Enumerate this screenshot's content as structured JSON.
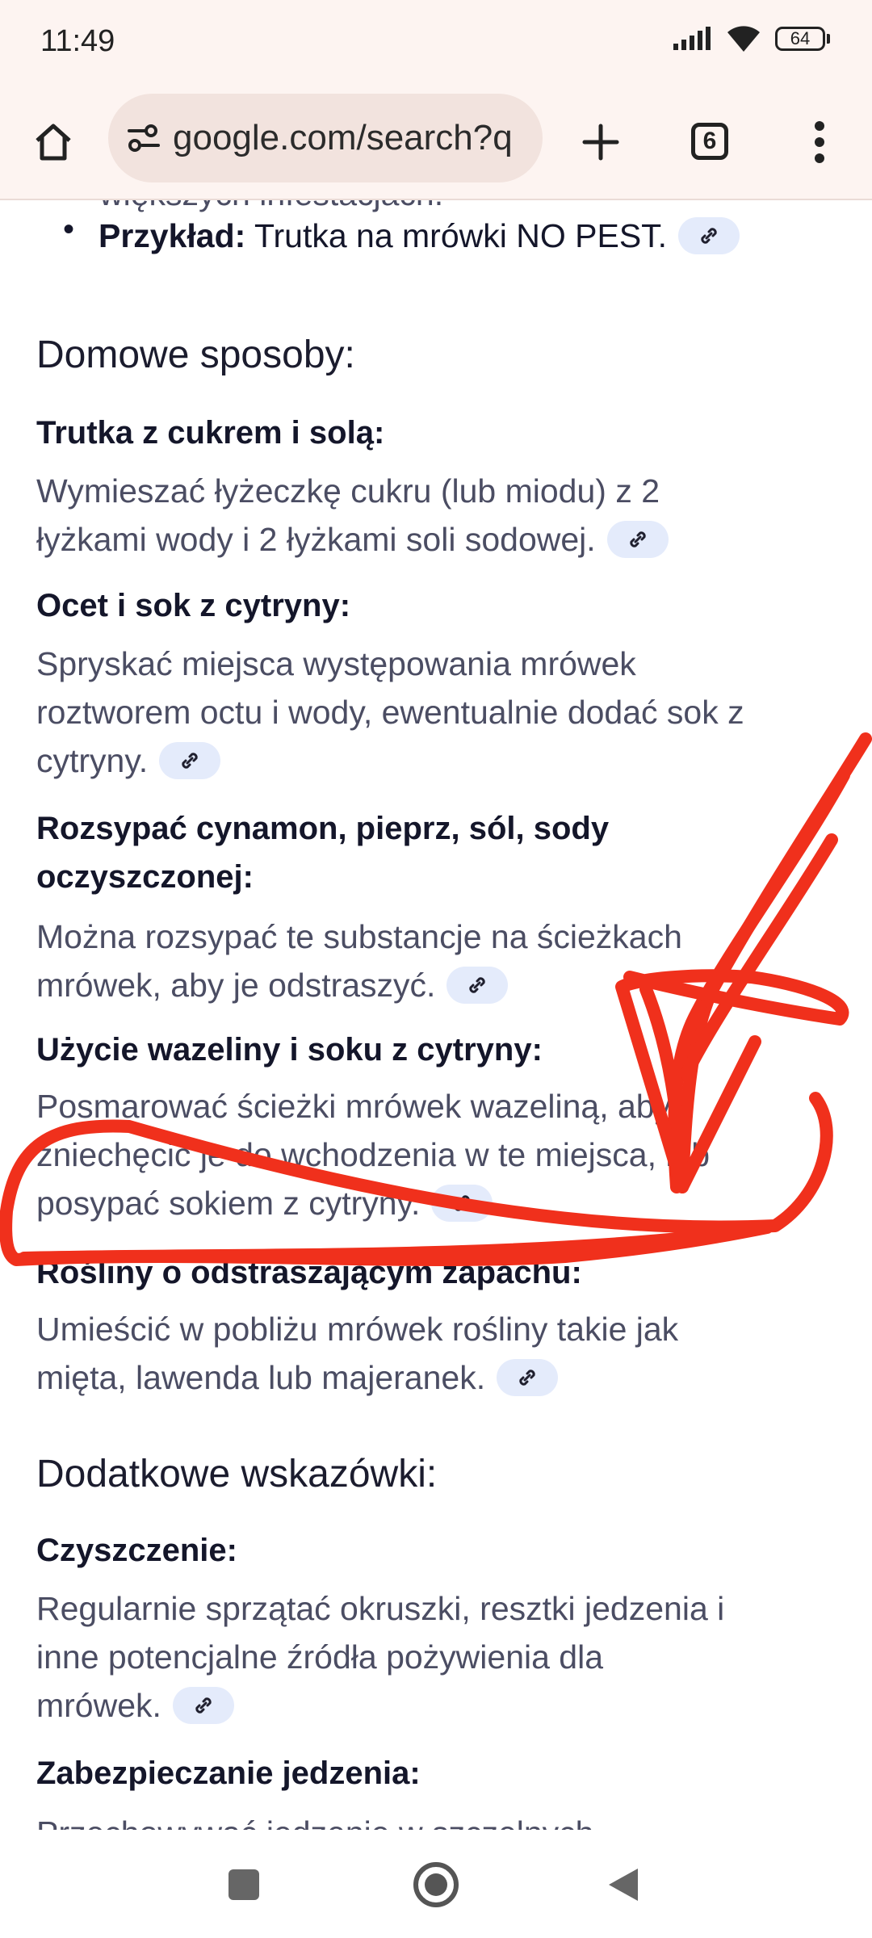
{
  "status": {
    "time": "11:49",
    "battery": "64"
  },
  "toolbar": {
    "url": "google.com/search?q",
    "tab_count": "6"
  },
  "content": {
    "partial_top": "większych infestacjach.",
    "bullet_label": "Przykład:",
    "bullet_text": "Trutka na mrówki NO PEST.",
    "section1": "Domowe sposoby:",
    "items": [
      {
        "title": "Trutka z cukrem i solą:",
        "lines": [
          "Wymieszać łyżeczkę cukru (lub miodu) z 2",
          "łyżkami wody i 2 łyżkami soli sodowej."
        ]
      },
      {
        "title": "Ocet i sok z cytryny:",
        "lines": [
          "Spryskać miejsca występowania mrówek",
          "roztworem octu i wody, ewentualnie dodać sok z",
          "cytryny."
        ]
      },
      {
        "title_lines": [
          "Rozsypać cynamon, pieprz, sól, sody",
          "oczyszczonej:"
        ],
        "lines": [
          "Można rozsypać te substancje na ścieżkach",
          "mrówek, aby je odstraszyć."
        ]
      },
      {
        "title": "Użycie wazeliny i soku z cytryny:",
        "lines": [
          "Posmarować ścieżki mrówek wazeliną, aby",
          "zniechęcić je do wchodzenia w te miejsca, lub",
          "posypać sokiem z cytryny."
        ]
      },
      {
        "title": "Rośliny o odstraszającym zapachu:",
        "lines": [
          "Umieścić w pobliżu mrówek rośliny takie jak",
          "mięta, lawenda lub majeranek."
        ]
      }
    ],
    "section2": "Dodatkowe wskazówki:",
    "items2": [
      {
        "title": "Czyszczenie:",
        "lines": [
          "Regularnie sprzątać okruszki, resztki jedzenia i",
          "inne potencjalne źródła pożywienia dla",
          "mrówek."
        ]
      },
      {
        "title": "Zabezpieczanie jedzenia:",
        "lines": [
          "Przechowywać jedzenie w szczelnych"
        ]
      }
    ]
  },
  "colors": {
    "annotation": "#f0301c",
    "chrome_bg": "#fdf4f1",
    "chip_bg": "#e4ebfb"
  }
}
